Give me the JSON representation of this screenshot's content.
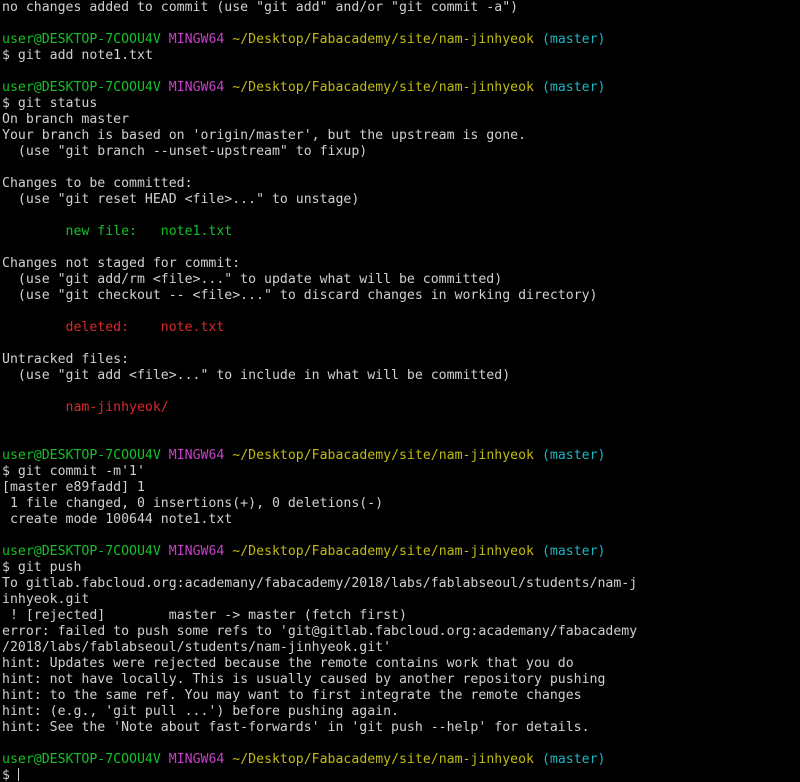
{
  "colors": {
    "background": "#000000",
    "text": "#d0d0d0",
    "prompt_user": "#13c02a",
    "prompt_shell": "#c341c4",
    "prompt_path": "#c0bb12",
    "prompt_branch": "#1bb6c0",
    "staged": "#13c02a",
    "unstaged": "#d72a2a"
  },
  "prompt": {
    "user_host": "user@DESKTOP-7COOU4V",
    "shell": "MINGW64",
    "path": "~/Desktop/Fabacademy/site/nam-jinhyeok",
    "branch": "(master)",
    "symbol": "$"
  },
  "lines": [
    {
      "type": "out",
      "text": "no changes added to commit (use \"git add\" and/or \"git commit -a\")"
    },
    {
      "type": "blank"
    },
    {
      "type": "prompt"
    },
    {
      "type": "cmd",
      "text": "git add note1.txt"
    },
    {
      "type": "blank"
    },
    {
      "type": "prompt"
    },
    {
      "type": "cmd",
      "text": "git status"
    },
    {
      "type": "out",
      "text": "On branch master"
    },
    {
      "type": "out",
      "text": "Your branch is based on 'origin/master', but the upstream is gone."
    },
    {
      "type": "out",
      "text": "  (use \"git branch --unset-upstream\" to fixup)"
    },
    {
      "type": "blank"
    },
    {
      "type": "out",
      "text": "Changes to be committed:"
    },
    {
      "type": "out",
      "text": "  (use \"git reset HEAD <file>...\" to unstage)"
    },
    {
      "type": "blank"
    },
    {
      "type": "green",
      "text": "        new file:   note1.txt"
    },
    {
      "type": "blank"
    },
    {
      "type": "out",
      "text": "Changes not staged for commit:"
    },
    {
      "type": "out",
      "text": "  (use \"git add/rm <file>...\" to update what will be committed)"
    },
    {
      "type": "out",
      "text": "  (use \"git checkout -- <file>...\" to discard changes in working directory)"
    },
    {
      "type": "blank"
    },
    {
      "type": "red",
      "text": "        deleted:    note.txt"
    },
    {
      "type": "blank"
    },
    {
      "type": "out",
      "text": "Untracked files:"
    },
    {
      "type": "out",
      "text": "  (use \"git add <file>...\" to include in what will be committed)"
    },
    {
      "type": "blank"
    },
    {
      "type": "red",
      "text": "        nam-jinhyeok/"
    },
    {
      "type": "blank"
    },
    {
      "type": "blank"
    },
    {
      "type": "prompt"
    },
    {
      "type": "cmd",
      "text": "git commit -m'1'"
    },
    {
      "type": "out",
      "text": "[master e89fadd] 1"
    },
    {
      "type": "out",
      "text": " 1 file changed, 0 insertions(+), 0 deletions(-)"
    },
    {
      "type": "out",
      "text": " create mode 100644 note1.txt"
    },
    {
      "type": "blank"
    },
    {
      "type": "prompt"
    },
    {
      "type": "cmd",
      "text": "git push"
    },
    {
      "type": "out",
      "text": "To gitlab.fabcloud.org:academany/fabacademy/2018/labs/fablabseoul/students/nam-j"
    },
    {
      "type": "out",
      "text": "inhyeok.git"
    },
    {
      "type": "out",
      "text": " ! [rejected]        master -> master (fetch first)"
    },
    {
      "type": "out",
      "text": "error: failed to push some refs to 'git@gitlab.fabcloud.org:academany/fabacademy"
    },
    {
      "type": "out",
      "text": "/2018/labs/fablabseoul/students/nam-jinhyeok.git'"
    },
    {
      "type": "out",
      "text": "hint: Updates were rejected because the remote contains work that you do"
    },
    {
      "type": "out",
      "text": "hint: not have locally. This is usually caused by another repository pushing"
    },
    {
      "type": "out",
      "text": "hint: to the same ref. You may want to first integrate the remote changes"
    },
    {
      "type": "out",
      "text": "hint: (e.g., 'git pull ...') before pushing again."
    },
    {
      "type": "out",
      "text": "hint: See the 'Note about fast-forwards' in 'git push --help' for details."
    },
    {
      "type": "blank"
    },
    {
      "type": "prompt"
    },
    {
      "type": "cursor"
    }
  ]
}
